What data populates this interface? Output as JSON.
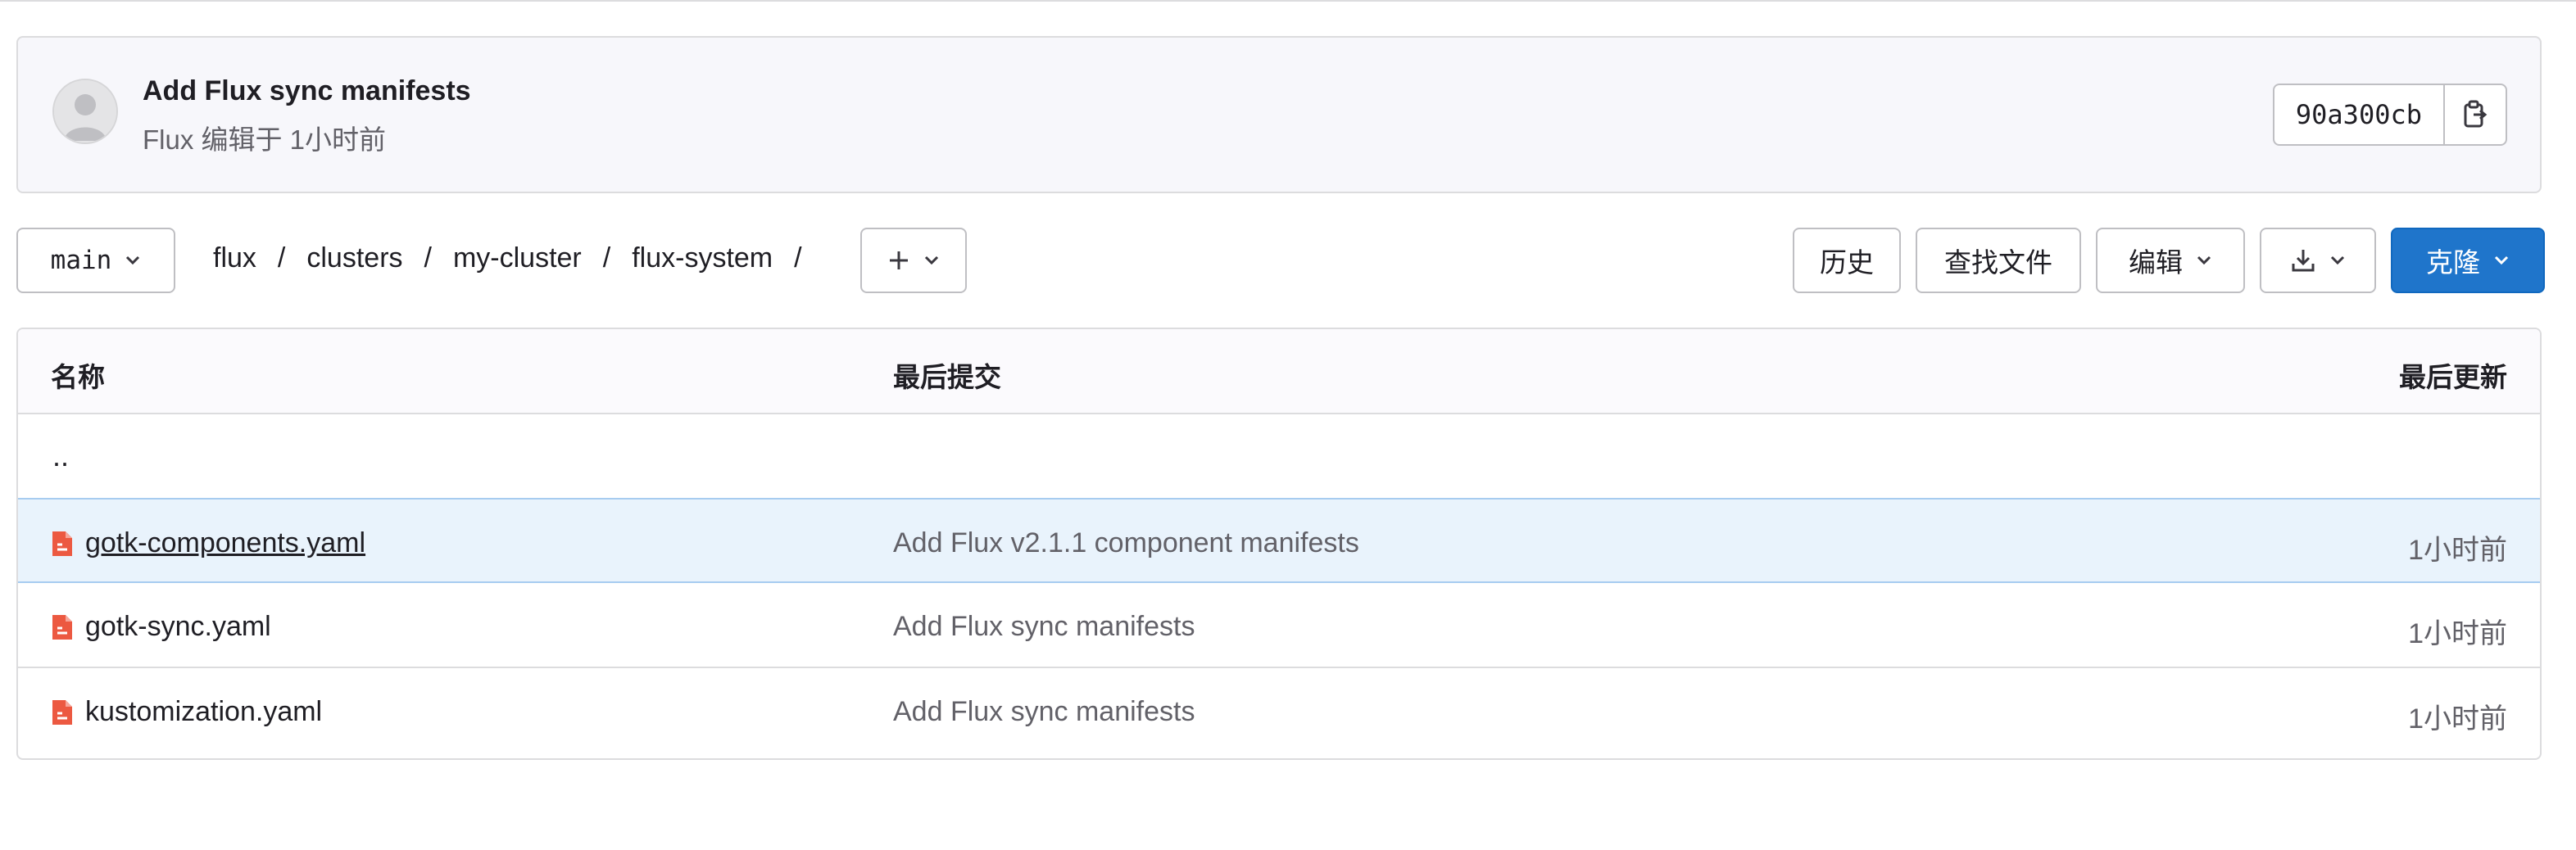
{
  "commit": {
    "title": "Add Flux sync manifests",
    "meta": "Flux 编辑于 1小时前",
    "sha": "90a300cb"
  },
  "toolbar": {
    "branch": "main",
    "breadcrumb": [
      "flux",
      "clusters",
      "my-cluster",
      "flux-system"
    ],
    "separator": "/",
    "history_label": "历史",
    "find_file_label": "查找文件",
    "edit_label": "编辑",
    "clone_label": "克隆"
  },
  "table": {
    "headers": {
      "name": "名称",
      "last_commit": "最后提交",
      "last_update": "最后更新"
    },
    "parent_dir": "..",
    "rows": [
      {
        "name": "gotk-components.yaml",
        "commit": "Add Flux v2.1.1 component manifests",
        "updated": "1小时前"
      },
      {
        "name": "gotk-sync.yaml",
        "commit": "Add Flux sync manifests",
        "updated": "1小时前"
      },
      {
        "name": "kustomization.yaml",
        "commit": "Add Flux sync manifests",
        "updated": "1小时前"
      }
    ]
  },
  "colors": {
    "accent": "#1f75cb",
    "file_icon": "#dd2b0e",
    "row_highlight": "#e9f3fc"
  },
  "icons": [
    "avatar-icon",
    "copy-icon",
    "chevron-down-icon",
    "plus-icon",
    "download-icon",
    "file-icon"
  ]
}
